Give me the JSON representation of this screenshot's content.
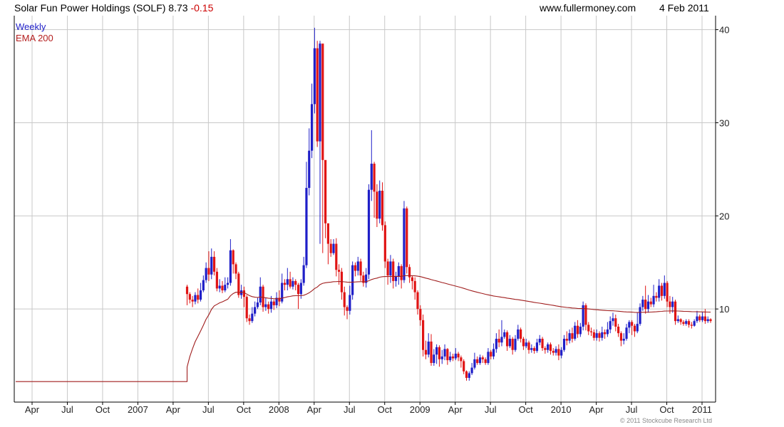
{
  "header": {
    "title": "Solar Fun Power Holdings (SOLF) 8.73",
    "change": "-0.15",
    "website": "www.fullermoney.com",
    "date": "4 Feb 2011"
  },
  "legend": {
    "weekly": "Weekly",
    "ema": "EMA 200"
  },
  "footer": "© 2011 Stockcube Research Ltd",
  "colors": {
    "up": "#1f1fc8",
    "down": "#e01414",
    "ema": "#a01e1e",
    "grid": "#c8c8c8"
  },
  "chart_data": {
    "type": "candlestick",
    "xlabel": "",
    "ylabel": "",
    "x_tick_labels": [
      "Apr",
      "Jul",
      "Oct",
      "2007",
      "Apr",
      "Jul",
      "Oct",
      "2008",
      "Apr",
      "Jul",
      "Oct",
      "2009",
      "Apr",
      "Jul",
      "Oct",
      "2010",
      "Apr",
      "Jul",
      "Oct",
      "2011"
    ],
    "y_ticks": [
      10,
      20,
      30,
      40
    ],
    "ylim": [
      0,
      41.5
    ],
    "ema_initial_value": 2.2,
    "weekly": [
      [
        12.4,
        11.6,
        12.6,
        10.4
      ],
      [
        11.6,
        11.0,
        11.8,
        10.6
      ],
      [
        11.0,
        10.8,
        11.4,
        10.2
      ],
      [
        10.8,
        11.5,
        11.8,
        10.5
      ],
      [
        11.5,
        11.0,
        12.2,
        10.6
      ],
      [
        11.0,
        12.0,
        12.8,
        10.8
      ],
      [
        12.0,
        13.1,
        13.6,
        11.8
      ],
      [
        13.1,
        14.4,
        15.0,
        12.8
      ],
      [
        14.4,
        13.7,
        16.2,
        13.0
      ],
      [
        13.7,
        15.6,
        16.5,
        13.2
      ],
      [
        15.6,
        14.0,
        16.2,
        13.6
      ],
      [
        14.0,
        12.2,
        14.4,
        11.9
      ],
      [
        12.2,
        12.5,
        13.2,
        11.8
      ],
      [
        12.5,
        12.0,
        13.0,
        11.7
      ],
      [
        12.0,
        12.6,
        13.4,
        11.8
      ],
      [
        12.6,
        12.8,
        13.4,
        12.2
      ],
      [
        12.8,
        16.3,
        17.5,
        12.5
      ],
      [
        16.3,
        14.8,
        16.4,
        13.8
      ],
      [
        14.8,
        13.8,
        15.0,
        13.2
      ],
      [
        13.8,
        11.5,
        14.0,
        11.2
      ],
      [
        11.5,
        12.0,
        12.6,
        11.1
      ],
      [
        12.0,
        11.3,
        12.4,
        10.2
      ],
      [
        11.3,
        9.0,
        11.5,
        8.6
      ],
      [
        9.0,
        8.7,
        9.4,
        8.3
      ],
      [
        8.7,
        9.5,
        10.2,
        8.5
      ],
      [
        9.5,
        10.2,
        10.8,
        9.2
      ],
      [
        10.2,
        10.7,
        11.2,
        10.0
      ],
      [
        10.7,
        12.4,
        13.4,
        10.4
      ],
      [
        12.4,
        10.2,
        12.6,
        9.7
      ],
      [
        10.2,
        10.5,
        11.2,
        9.8
      ],
      [
        10.5,
        10.0,
        10.8,
        9.5
      ],
      [
        10.0,
        10.8,
        11.4,
        9.6
      ],
      [
        10.8,
        10.4,
        11.0,
        9.9
      ],
      [
        10.4,
        11.2,
        11.8,
        10.1
      ],
      [
        11.2,
        10.8,
        12.0,
        10.3
      ],
      [
        10.8,
        12.8,
        13.8,
        10.6
      ],
      [
        12.8,
        12.6,
        13.2,
        12.0
      ],
      [
        12.6,
        13.2,
        14.4,
        12.0
      ],
      [
        13.2,
        12.4,
        14.0,
        12.2
      ],
      [
        12.4,
        13.0,
        13.4,
        12.1
      ],
      [
        13.0,
        12.6,
        13.2,
        12.0
      ],
      [
        12.6,
        11.6,
        12.8,
        10.0
      ],
      [
        11.6,
        12.8,
        13.2,
        11.1
      ],
      [
        12.8,
        14.7,
        15.6,
        12.5
      ],
      [
        14.7,
        23.0,
        25.8,
        14.4
      ],
      [
        23.0,
        27.0,
        29.4,
        22.2
      ],
      [
        27.0,
        32.0,
        34.2,
        26.2
      ],
      [
        32.0,
        38.0,
        40.2,
        31.0
      ],
      [
        38.0,
        28.0,
        38.8,
        27.4
      ],
      [
        28.0,
        38.5,
        38.8,
        17.0
      ],
      [
        38.5,
        26.0,
        26.5,
        16.0
      ],
      [
        26.0,
        19.2,
        20.4,
        17.6
      ],
      [
        19.2,
        17.0,
        17.6,
        14.8
      ],
      [
        17.0,
        16.0,
        17.5,
        15.6
      ],
      [
        16.0,
        17.0,
        17.5,
        15.8
      ],
      [
        17.0,
        14.2,
        17.6,
        13.5
      ],
      [
        14.2,
        14.0,
        14.8,
        12.6
      ],
      [
        14.0,
        11.8,
        14.4,
        11.0
      ],
      [
        11.8,
        10.2,
        12.4,
        9.3
      ],
      [
        10.2,
        9.8,
        10.4,
        8.9
      ],
      [
        9.8,
        11.5,
        12.5,
        9.4
      ],
      [
        11.5,
        14.7,
        15.1,
        11.0
      ],
      [
        14.7,
        14.1,
        15.0,
        13.5
      ],
      [
        14.1,
        15.1,
        15.6,
        13.6
      ],
      [
        15.1,
        13.6,
        15.4,
        13.0
      ],
      [
        13.6,
        12.8,
        14.0,
        12.4
      ],
      [
        12.8,
        13.7,
        14.4,
        12.3
      ],
      [
        13.7,
        22.8,
        23.4,
        13.2
      ],
      [
        22.8,
        25.6,
        29.2,
        21.6
      ],
      [
        25.6,
        22.6,
        25.8,
        19.8
      ],
      [
        22.6,
        19.7,
        23.4,
        18.8
      ],
      [
        19.7,
        22.7,
        23.8,
        19.2
      ],
      [
        22.7,
        19.0,
        23.6,
        18.4
      ],
      [
        19.0,
        15.1,
        19.4,
        14.4
      ],
      [
        15.1,
        13.6,
        15.4,
        12.6
      ],
      [
        13.6,
        15.1,
        15.8,
        12.8
      ],
      [
        15.1,
        13.0,
        15.4,
        12.2
      ],
      [
        13.0,
        13.5,
        14.0,
        12.4
      ],
      [
        13.5,
        14.6,
        15.0,
        12.6
      ],
      [
        14.6,
        13.1,
        14.8,
        12.2
      ],
      [
        13.1,
        20.8,
        21.6,
        12.8
      ],
      [
        20.8,
        14.5,
        21.0,
        13.8
      ],
      [
        14.5,
        13.4,
        14.8,
        12.8
      ],
      [
        13.4,
        13.0,
        13.6,
        12.1
      ],
      [
        13.0,
        11.8,
        13.4,
        11.0
      ],
      [
        11.8,
        10.0,
        12.0,
        9.4
      ],
      [
        10.0,
        8.8,
        10.4,
        8.2
      ],
      [
        8.8,
        5.6,
        9.4,
        4.9
      ],
      [
        5.6,
        5.1,
        6.6,
        4.6
      ],
      [
        5.1,
        6.5,
        7.4,
        4.8
      ],
      [
        6.5,
        4.2,
        7.3,
        3.9
      ],
      [
        4.2,
        5.1,
        5.7,
        3.9
      ],
      [
        5.1,
        5.9,
        6.2,
        4.1
      ],
      [
        5.9,
        4.6,
        6.1,
        3.8
      ],
      [
        4.6,
        4.9,
        5.6,
        4.1
      ],
      [
        4.9,
        5.7,
        6.2,
        4.5
      ],
      [
        5.7,
        4.5,
        5.8,
        4.0
      ],
      [
        4.5,
        4.9,
        5.4,
        4.3
      ],
      [
        4.9,
        4.7,
        5.2,
        4.4
      ],
      [
        4.7,
        5.2,
        5.8,
        4.5
      ],
      [
        5.2,
        4.8,
        5.4,
        4.4
      ],
      [
        4.8,
        4.4,
        5.0,
        3.7
      ],
      [
        4.4,
        3.3,
        4.6,
        3.0
      ],
      [
        3.3,
        2.6,
        3.4,
        2.3
      ],
      [
        2.6,
        3.1,
        3.3,
        2.3
      ],
      [
        3.1,
        3.7,
        4.2,
        2.9
      ],
      [
        3.7,
        4.6,
        5.3,
        3.5
      ],
      [
        4.6,
        4.2,
        4.9,
        4.0
      ],
      [
        4.2,
        4.8,
        5.1,
        4.0
      ],
      [
        4.8,
        4.6,
        5.0,
        4.2
      ],
      [
        4.6,
        4.2,
        4.8,
        4.0
      ],
      [
        4.2,
        5.4,
        5.8,
        4.0
      ],
      [
        5.4,
        4.9,
        5.6,
        4.6
      ],
      [
        4.9,
        5.7,
        6.3,
        4.6
      ],
      [
        5.7,
        6.8,
        7.4,
        5.3
      ],
      [
        6.8,
        6.4,
        7.8,
        5.9
      ],
      [
        6.4,
        7.0,
        8.8,
        6.0
      ],
      [
        7.0,
        7.5,
        7.8,
        6.8
      ],
      [
        7.5,
        6.0,
        7.7,
        5.5
      ],
      [
        6.0,
        6.8,
        7.2,
        5.8
      ],
      [
        6.8,
        5.6,
        7.0,
        5.1
      ],
      [
        5.6,
        6.8,
        7.2,
        5.4
      ],
      [
        6.8,
        7.8,
        8.3,
        6.6
      ],
      [
        7.8,
        6.8,
        8.0,
        6.4
      ],
      [
        6.8,
        6.0,
        7.0,
        5.6
      ],
      [
        6.0,
        6.4,
        6.8,
        5.8
      ],
      [
        6.4,
        5.6,
        6.6,
        5.2
      ],
      [
        5.6,
        5.8,
        6.2,
        5.3
      ],
      [
        5.8,
        5.5,
        6.0,
        5.2
      ],
      [
        5.5,
        6.4,
        6.8,
        5.3
      ],
      [
        6.4,
        6.8,
        7.2,
        6.1
      ],
      [
        6.8,
        5.8,
        7.0,
        5.5
      ],
      [
        5.8,
        5.6,
        6.0,
        5.2
      ],
      [
        5.6,
        6.2,
        6.4,
        5.3
      ],
      [
        6.2,
        5.5,
        6.4,
        5.1
      ],
      [
        5.5,
        5.3,
        5.8,
        5.0
      ],
      [
        5.3,
        5.7,
        6.0,
        5.0
      ],
      [
        5.7,
        5.0,
        6.2,
        4.5
      ],
      [
        5.0,
        5.6,
        5.9,
        4.7
      ],
      [
        5.6,
        6.8,
        7.2,
        5.4
      ],
      [
        6.8,
        6.6,
        7.6,
        6.1
      ],
      [
        6.6,
        7.4,
        7.8,
        6.3
      ],
      [
        7.4,
        6.8,
        8.0,
        6.4
      ],
      [
        6.8,
        8.2,
        8.6,
        6.6
      ],
      [
        8.2,
        7.3,
        8.8,
        6.9
      ],
      [
        7.3,
        8.1,
        8.5,
        7.0
      ],
      [
        8.1,
        10.4,
        10.8,
        7.7
      ],
      [
        10.4,
        8.3,
        10.6,
        7.7
      ],
      [
        8.3,
        7.6,
        8.6,
        7.2
      ],
      [
        7.6,
        7.5,
        8.0,
        7.1
      ],
      [
        7.5,
        6.9,
        7.8,
        6.6
      ],
      [
        6.9,
        7.4,
        7.8,
        6.6
      ],
      [
        7.4,
        6.9,
        7.6,
        6.5
      ],
      [
        6.9,
        7.5,
        8.1,
        6.6
      ],
      [
        7.5,
        7.3,
        7.8,
        6.8
      ],
      [
        7.3,
        7.8,
        8.6,
        7.0
      ],
      [
        7.8,
        8.7,
        9.2,
        7.4
      ],
      [
        8.7,
        9.0,
        9.6,
        8.2
      ],
      [
        9.0,
        8.1,
        9.4,
        7.6
      ],
      [
        8.1,
        7.4,
        8.4,
        7.0
      ],
      [
        7.4,
        6.6,
        7.6,
        6.0
      ],
      [
        6.6,
        6.8,
        7.4,
        6.2
      ],
      [
        6.8,
        8.0,
        8.4,
        6.6
      ],
      [
        8.0,
        8.6,
        8.8,
        7.4
      ],
      [
        8.6,
        8.2,
        8.8,
        7.2
      ],
      [
        8.2,
        7.6,
        8.4,
        7.0
      ],
      [
        7.6,
        8.4,
        9.6,
        7.4
      ],
      [
        8.4,
        10.2,
        10.6,
        8.2
      ],
      [
        10.2,
        11.0,
        11.4,
        9.8
      ],
      [
        11.0,
        10.0,
        12.5,
        9.5
      ],
      [
        10.0,
        10.8,
        11.5,
        9.6
      ],
      [
        10.8,
        10.5,
        11.2,
        10.2
      ],
      [
        10.5,
        11.4,
        12.6,
        10.2
      ],
      [
        11.4,
        11.2,
        11.8,
        10.8
      ],
      [
        11.2,
        12.5,
        13.2,
        10.8
      ],
      [
        12.5,
        11.4,
        12.8,
        10.9
      ],
      [
        11.4,
        12.8,
        13.6,
        11.1
      ],
      [
        12.8,
        10.8,
        13.0,
        10.2
      ],
      [
        10.8,
        10.2,
        11.4,
        9.5
      ],
      [
        10.2,
        10.8,
        11.3,
        9.6
      ],
      [
        10.8,
        8.7,
        11.0,
        8.3
      ],
      [
        8.7,
        8.9,
        9.3,
        8.5
      ],
      [
        8.9,
        8.6,
        9.0,
        8.3
      ],
      [
        8.6,
        8.4,
        8.8,
        8.2
      ],
      [
        8.4,
        8.7,
        8.9,
        8.2
      ],
      [
        8.7,
        8.3,
        8.9,
        8.0
      ],
      [
        8.3,
        8.2,
        8.6,
        7.9
      ],
      [
        8.2,
        8.7,
        8.9,
        8.1
      ],
      [
        8.7,
        9.2,
        9.8,
        8.5
      ],
      [
        9.2,
        8.8,
        9.4,
        8.6
      ],
      [
        8.8,
        9.2,
        9.7,
        8.6
      ],
      [
        9.2,
        8.7,
        10.0,
        8.4
      ],
      [
        8.7,
        8.9,
        9.2,
        8.5
      ],
      [
        8.9,
        8.7,
        9.0,
        8.5
      ]
    ]
  }
}
